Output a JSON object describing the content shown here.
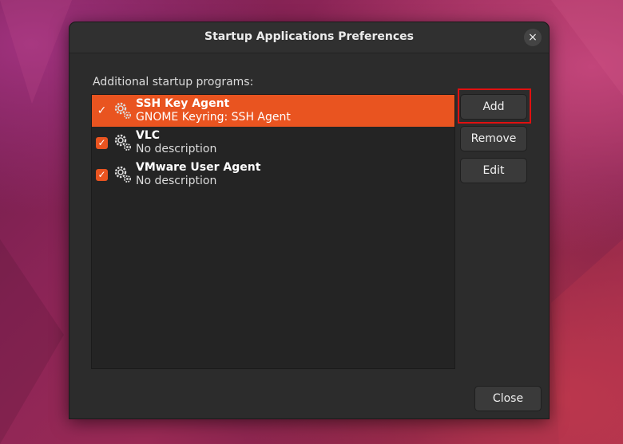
{
  "window": {
    "title": "Startup Applications Preferences"
  },
  "section_label": "Additional startup programs:",
  "programs": [
    {
      "name": "SSH Key Agent",
      "description": "GNOME Keyring: SSH Agent",
      "enabled": true,
      "selected": true,
      "icon": "gears-icon"
    },
    {
      "name": "VLC",
      "description": "No description",
      "enabled": true,
      "selected": false,
      "icon": "gears-icon"
    },
    {
      "name": "VMware User Agent",
      "description": "No description",
      "enabled": true,
      "selected": false,
      "icon": "gears-icon"
    }
  ],
  "buttons": {
    "add": "Add",
    "remove": "Remove",
    "edit": "Edit",
    "close": "Close"
  },
  "icons": {
    "close": "×",
    "check": "✓"
  },
  "colors": {
    "accent": "#e95420",
    "highlight": "#e01010"
  }
}
